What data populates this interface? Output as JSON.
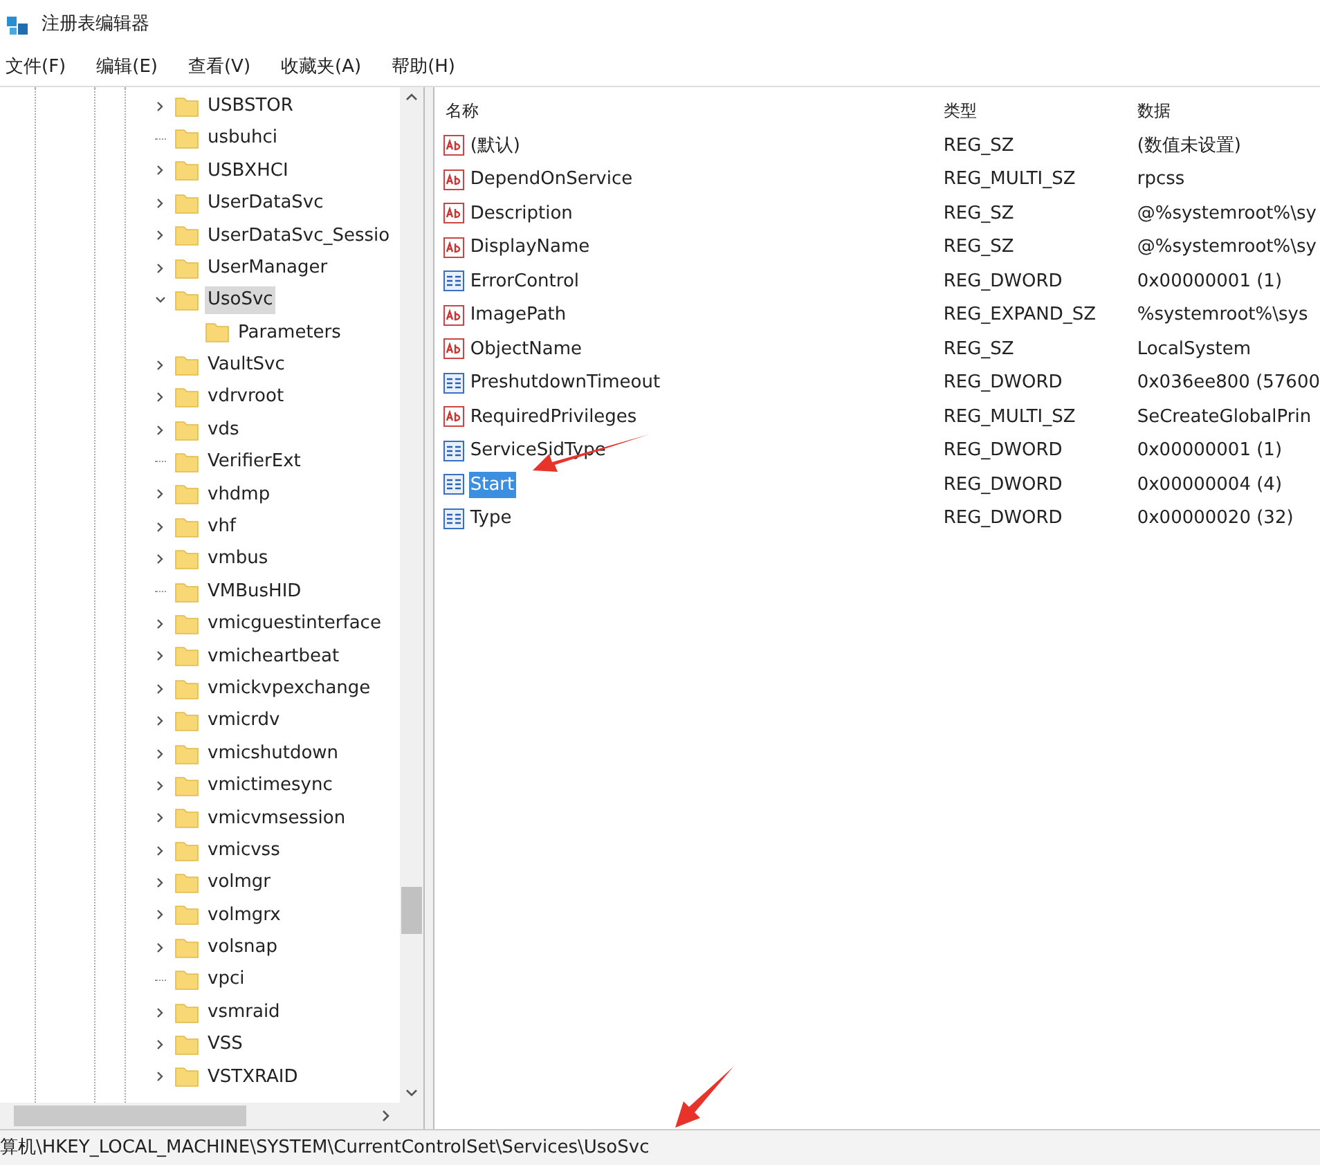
{
  "window": {
    "title": "注册表编辑器"
  },
  "menu": [
    "文件(F)",
    "编辑(E)",
    "查看(V)",
    "收藏夹(A)",
    "帮助(H)"
  ],
  "tree": [
    {
      "label": "USBSTOR",
      "has_children": true,
      "expanded": false,
      "selected": false
    },
    {
      "label": "usbuhci",
      "has_children": false,
      "expanded": false,
      "selected": false
    },
    {
      "label": "USBXHCI",
      "has_children": true,
      "expanded": false,
      "selected": false
    },
    {
      "label": "UserDataSvc",
      "has_children": true,
      "expanded": false,
      "selected": false
    },
    {
      "label": "UserDataSvc_Sessio",
      "has_children": true,
      "expanded": false,
      "selected": false
    },
    {
      "label": "UserManager",
      "has_children": true,
      "expanded": false,
      "selected": false
    },
    {
      "label": "UsoSvc",
      "has_children": true,
      "expanded": true,
      "selected": true,
      "children": [
        {
          "label": "Parameters",
          "selected": false
        }
      ]
    },
    {
      "label": "VaultSvc",
      "has_children": true,
      "expanded": false,
      "selected": false
    },
    {
      "label": "vdrvroot",
      "has_children": true,
      "expanded": false,
      "selected": false
    },
    {
      "label": "vds",
      "has_children": true,
      "expanded": false,
      "selected": false
    },
    {
      "label": "VerifierExt",
      "has_children": false,
      "expanded": false,
      "selected": false
    },
    {
      "label": "vhdmp",
      "has_children": true,
      "expanded": false,
      "selected": false
    },
    {
      "label": "vhf",
      "has_children": true,
      "expanded": false,
      "selected": false
    },
    {
      "label": "vmbus",
      "has_children": true,
      "expanded": false,
      "selected": false
    },
    {
      "label": "VMBusHID",
      "has_children": false,
      "expanded": false,
      "selected": false
    },
    {
      "label": "vmicguestinterface",
      "has_children": true,
      "expanded": false,
      "selected": false
    },
    {
      "label": "vmicheartbeat",
      "has_children": true,
      "expanded": false,
      "selected": false
    },
    {
      "label": "vmickvpexchange",
      "has_children": true,
      "expanded": false,
      "selected": false
    },
    {
      "label": "vmicrdv",
      "has_children": true,
      "expanded": false,
      "selected": false
    },
    {
      "label": "vmicshutdown",
      "has_children": true,
      "expanded": false,
      "selected": false
    },
    {
      "label": "vmictimesync",
      "has_children": true,
      "expanded": false,
      "selected": false
    },
    {
      "label": "vmicvmsession",
      "has_children": true,
      "expanded": false,
      "selected": false
    },
    {
      "label": "vmicvss",
      "has_children": true,
      "expanded": false,
      "selected": false
    },
    {
      "label": "volmgr",
      "has_children": true,
      "expanded": false,
      "selected": false
    },
    {
      "label": "volmgrx",
      "has_children": true,
      "expanded": false,
      "selected": false
    },
    {
      "label": "volsnap",
      "has_children": true,
      "expanded": false,
      "selected": false
    },
    {
      "label": "vpci",
      "has_children": false,
      "expanded": false,
      "selected": false
    },
    {
      "label": "vsmraid",
      "has_children": true,
      "expanded": false,
      "selected": false
    },
    {
      "label": "VSS",
      "has_children": true,
      "expanded": false,
      "selected": false
    },
    {
      "label": "VSTXRAID",
      "has_children": true,
      "expanded": false,
      "selected": false
    }
  ],
  "table": {
    "columns": [
      "名称",
      "类型",
      "数据"
    ],
    "rows": [
      {
        "kind": "string",
        "name": "(默认)",
        "type": "REG_SZ",
        "data": "(数值未设置)",
        "selected": false
      },
      {
        "kind": "string",
        "name": "DependOnService",
        "type": "REG_MULTI_SZ",
        "data": "rpcss",
        "selected": false
      },
      {
        "kind": "string",
        "name": "Description",
        "type": "REG_SZ",
        "data": "@%systemroot%\\sy",
        "selected": false
      },
      {
        "kind": "string",
        "name": "DisplayName",
        "type": "REG_SZ",
        "data": "@%systemroot%\\sy",
        "selected": false
      },
      {
        "kind": "binary",
        "name": "ErrorControl",
        "type": "REG_DWORD",
        "data": "0x00000001 (1)",
        "selected": false
      },
      {
        "kind": "string",
        "name": "ImagePath",
        "type": "REG_EXPAND_SZ",
        "data": "%systemroot%\\sys",
        "selected": false
      },
      {
        "kind": "string",
        "name": "ObjectName",
        "type": "REG_SZ",
        "data": "LocalSystem",
        "selected": false
      },
      {
        "kind": "binary",
        "name": "PreshutdownTimeout",
        "type": "REG_DWORD",
        "data": "0x036ee800 (57600",
        "selected": false
      },
      {
        "kind": "string",
        "name": "RequiredPrivileges",
        "type": "REG_MULTI_SZ",
        "data": "SeCreateGlobalPrin",
        "selected": false
      },
      {
        "kind": "binary",
        "name": "ServiceSidType",
        "type": "REG_DWORD",
        "data": "0x00000001 (1)",
        "selected": false
      },
      {
        "kind": "binary",
        "name": "Start",
        "type": "REG_DWORD",
        "data": "0x00000004 (4)",
        "selected": true
      },
      {
        "kind": "binary",
        "name": "Type",
        "type": "REG_DWORD",
        "data": "0x00000020 (32)",
        "selected": false
      }
    ]
  },
  "status_bar": {
    "path": "算机\\HKEY_LOCAL_MACHINE\\SYSTEM\\CurrentControlSet\\Services\\UsoSvc"
  }
}
